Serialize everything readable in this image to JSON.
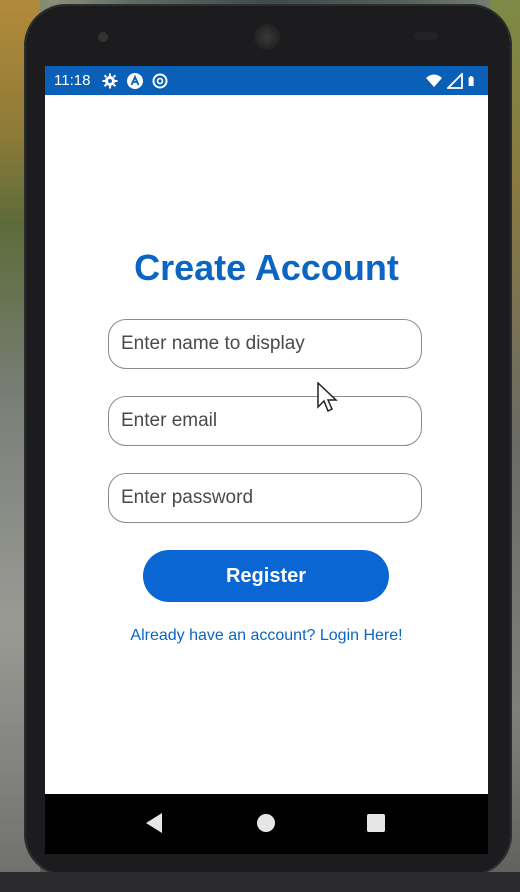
{
  "status_bar": {
    "time": "11:18",
    "icons_left": [
      "gear-icon",
      "app-a-icon",
      "sync-icon"
    ],
    "icons_right": [
      "wifi-icon",
      "signal-icon",
      "battery-icon"
    ],
    "background_color": "#0a60b6"
  },
  "form": {
    "title": "Create Account",
    "name_placeholder": "Enter name to display",
    "email_placeholder": "Enter email",
    "password_placeholder": "Enter password",
    "register_label": "Register",
    "login_link": "Already have an account? Login Here!",
    "accent_color": "#0a66c2"
  },
  "nav_bar": {
    "buttons": [
      "back-icon",
      "home-icon",
      "recents-icon"
    ]
  }
}
